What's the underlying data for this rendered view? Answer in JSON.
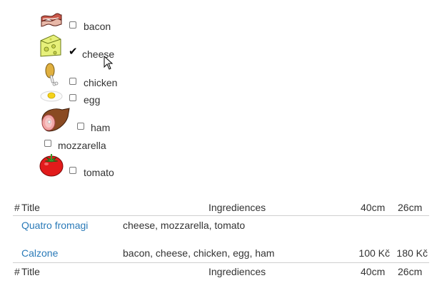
{
  "filters": [
    {
      "label": "bacon",
      "checked": false,
      "icon": "bacon-icon"
    },
    {
      "label": "cheese",
      "checked": true,
      "icon": "cheese-icon"
    },
    {
      "label": "chicken",
      "checked": false,
      "icon": "chicken-leg-icon"
    },
    {
      "label": "egg",
      "checked": false,
      "icon": "fried-egg-icon"
    },
    {
      "label": "ham",
      "checked": false,
      "icon": "ham-icon"
    },
    {
      "label": "mozzarella",
      "checked": false,
      "icon": ""
    },
    {
      "label": "tomato",
      "checked": false,
      "icon": "tomato-icon"
    }
  ],
  "table": {
    "header": {
      "hash": "#",
      "title": "Title",
      "ingredients": "Ingrediences",
      "size40": "40cm",
      "size26": "26cm"
    },
    "rows": [
      {
        "title": "Quatro fromagi",
        "ingredients": "cheese, mozzarella, tomato",
        "price40": "",
        "price26": ""
      },
      {
        "title": "Calzone",
        "ingredients": "bacon, cheese, chicken, egg, ham",
        "price40": "100 Kč",
        "price26": "180 Kč"
      }
    ],
    "footer": {
      "hash": "#",
      "title": "Title",
      "ingredients": "Ingrediences",
      "size40": "40cm",
      "size26": "26cm"
    }
  },
  "colors": {
    "link": "#2a7ab8",
    "text": "#333333",
    "rule": "#cfcfcf"
  }
}
